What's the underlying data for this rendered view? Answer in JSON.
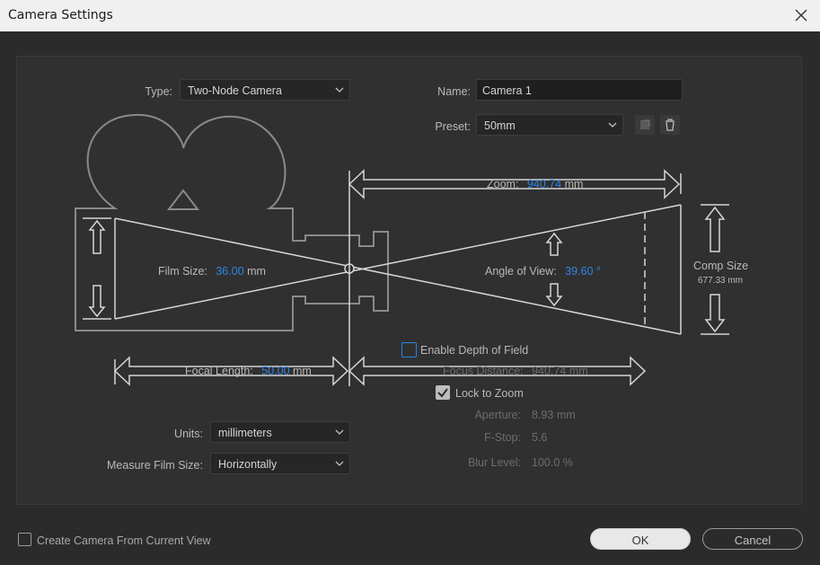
{
  "window": {
    "title": "Camera Settings",
    "close_icon": "close-icon"
  },
  "type": {
    "label": "Type:",
    "value": "Two-Node Camera"
  },
  "name": {
    "label": "Name:",
    "value": "Camera 1"
  },
  "preset": {
    "label": "Preset:",
    "value": "50mm",
    "save_icon": "save-preset-icon",
    "delete_icon": "trash-icon"
  },
  "zoom": {
    "label": "Zoom:",
    "value": "940.74",
    "unit": "mm"
  },
  "film_size": {
    "label": "Film Size:",
    "value": "36.00",
    "unit": "mm"
  },
  "angle_of_view": {
    "label": "Angle of View:",
    "value": "39.60",
    "unit": "°"
  },
  "comp_size": {
    "label": "Comp Size",
    "value": "677.33 mm"
  },
  "focal_length": {
    "label": "Focal Length:",
    "value": "50.00",
    "unit": "mm"
  },
  "depth_of_field": {
    "label": "Enable Depth of Field",
    "checked": false
  },
  "focus_distance": {
    "label": "Focus Distance:",
    "value": "940.74",
    "unit": "mm"
  },
  "lock_to_zoom": {
    "label": "Lock to Zoom",
    "checked": true
  },
  "aperture": {
    "label": "Aperture:",
    "value": "8.93",
    "unit": "mm"
  },
  "fstop": {
    "label": "F-Stop:",
    "value": "5.6"
  },
  "blur_level": {
    "label": "Blur Level:",
    "value": "100.0",
    "unit": "%"
  },
  "units": {
    "label": "Units:",
    "value": "millimeters"
  },
  "measure_film_size": {
    "label": "Measure Film Size:",
    "value": "Horizontally"
  },
  "create_from_view": {
    "label": "Create Camera From Current View",
    "checked": false
  },
  "buttons": {
    "ok": "OK",
    "cancel": "Cancel"
  },
  "colors": {
    "accent": "#2e86e6",
    "diagram_line": "#8a8a8a",
    "background": "#2b2b2b"
  }
}
